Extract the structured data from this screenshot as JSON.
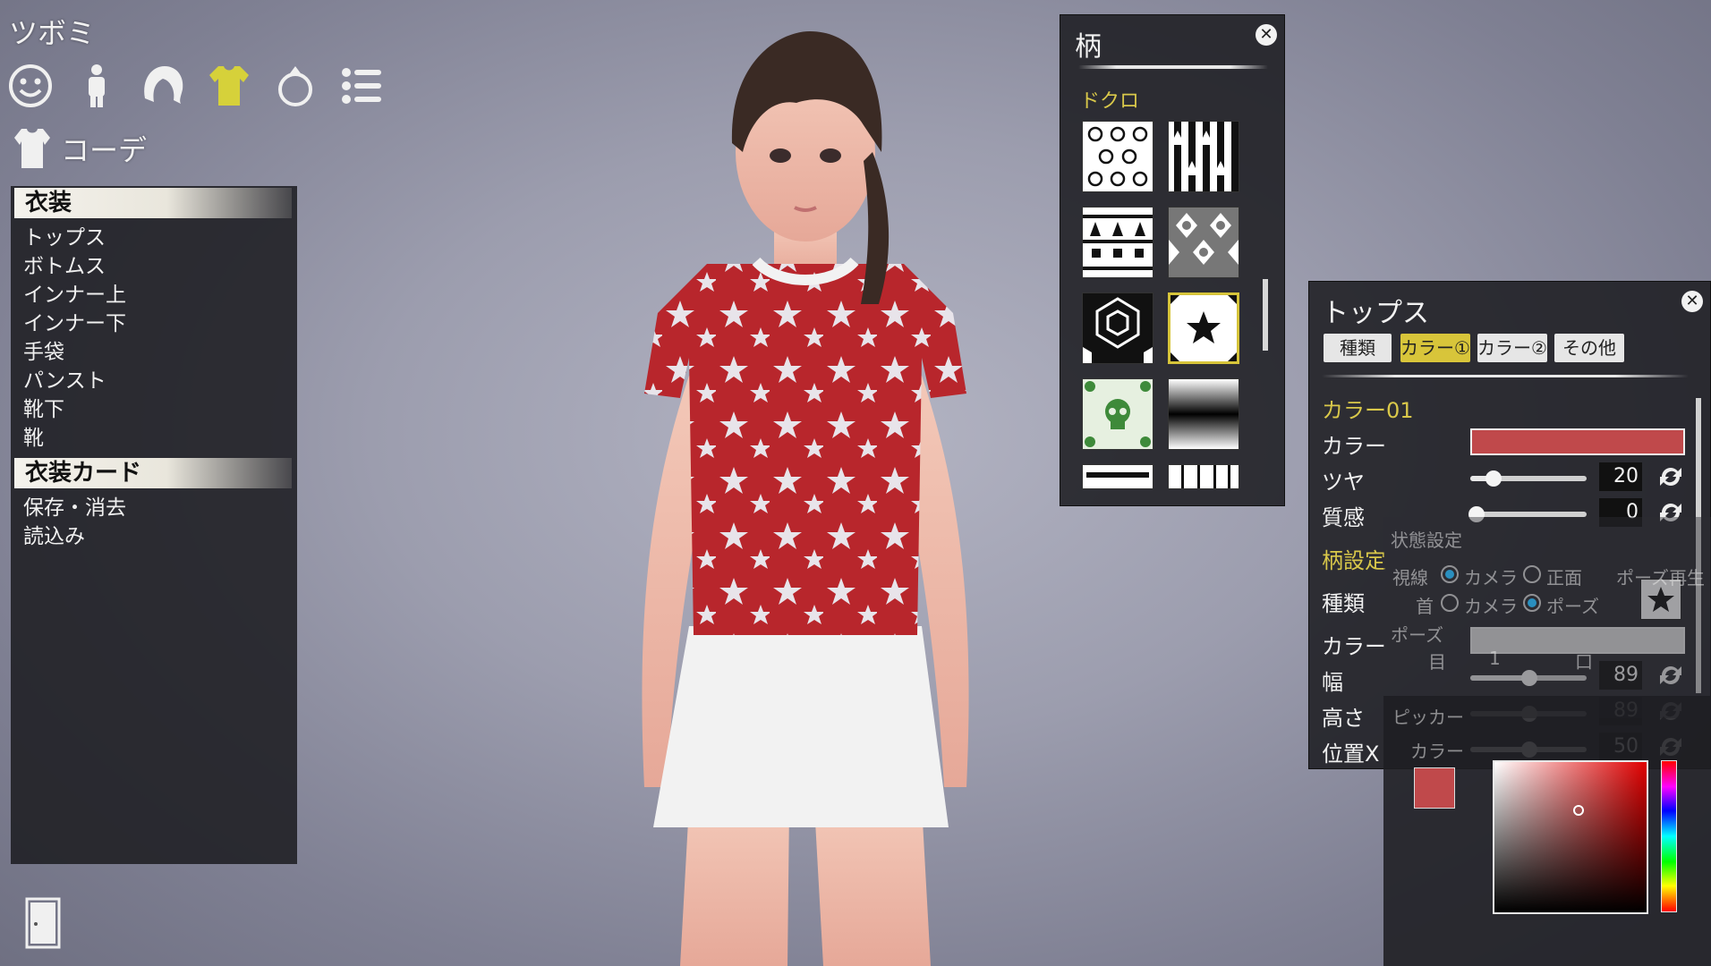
{
  "character_name": "ツボミ",
  "category_icons": [
    "face-icon",
    "body-icon",
    "hair-icon",
    "clothes-icon",
    "accessory-icon",
    "list-icon"
  ],
  "active_category": "clothes-icon",
  "coord_title": "コーデ",
  "left_menu": {
    "clothing_header": "衣装",
    "clothing_items": [
      "トップス",
      "ボトムス",
      "インナー上",
      "インナー下",
      "手袋",
      "パンスト",
      "靴下",
      "靴"
    ],
    "card_header": "衣装カード",
    "card_items": [
      "保存・消去",
      "読込み"
    ]
  },
  "pattern_window": {
    "title": "柄",
    "category": "ドクロ",
    "close_label": "✕"
  },
  "tops_panel": {
    "title": "トップス",
    "close_label": "✕",
    "tabs": [
      {
        "label": "種類",
        "active": false
      },
      {
        "label": "カラー①",
        "active": true
      },
      {
        "label": "カラー②",
        "active": false
      },
      {
        "label": "その他",
        "active": false
      }
    ],
    "section_color": "カラー01",
    "color_label": "カラー",
    "color_value": "#c0494b",
    "gloss_label": "ツヤ",
    "gloss_value": "20",
    "texture_label": "質感",
    "texture_value": "0",
    "section_pattern": "柄設定",
    "type_label": "種類",
    "pattern_color_label": "カラー",
    "pattern_color_value": "#e6e6e6",
    "width_label": "幅",
    "width_value": "89",
    "height_label": "高さ",
    "height_value": "89",
    "pos_x_label": "位置X",
    "pos_x_value": "50"
  },
  "status_panel": {
    "title": "状態設定",
    "gaze_label": "視線",
    "neck_label": "首",
    "opt_camera": "カメラ",
    "opt_front": "正面",
    "opt_pose": "ポーズ",
    "pose_play_label": "ポーズ再生",
    "pose_label": "ポーズ",
    "eye_label": "目",
    "eye_value": "1",
    "mouth_label": "口"
  },
  "color_picker": {
    "picker_label": "ピッカー",
    "color_label": "カラー",
    "current_color": "#c0494b"
  },
  "colors": {
    "accent": "#d9c84a",
    "panel_bg": "#1e1e22",
    "shirt_red": "#b8262c"
  }
}
